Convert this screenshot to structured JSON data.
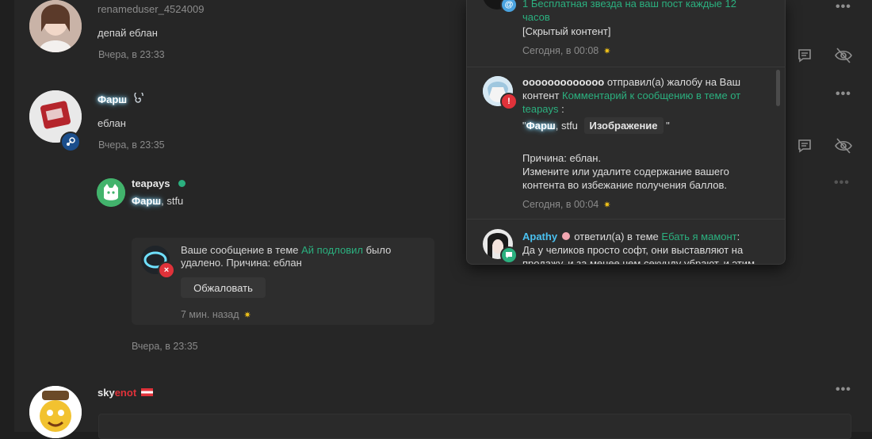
{
  "feed": {
    "post1": {
      "username": "renameduser_4524009",
      "text": "депай еблан",
      "time": "Вчера, в 23:33"
    },
    "post2": {
      "username": "Фарш",
      "text": "еблан",
      "time": "Вчера, в 23:35"
    },
    "reply": {
      "username": "teapays",
      "name_prefix": "Фарш",
      "text": ", stfu"
    },
    "notice": {
      "text_before": "Ваше сообщение в теме ",
      "link": "Ай подловил",
      "text_after": " было удалено. Причина: еблан",
      "button": "Обжаловать",
      "time": "7 мин. назад"
    },
    "reply_time": "Вчера, в 23:35",
    "post3": {
      "user_part1": "sky",
      "user_part2": "enot"
    }
  },
  "popup": {
    "n1": {
      "link": "1 Бесплатная звезда на ваш пост каждые 12 часов",
      "text": "[Скрытый контент]",
      "time": "Сегодня, в 00:08"
    },
    "n2": {
      "user": "ооооооооооооо",
      "text1": " отправил(а) жалобу на Ваш контент ",
      "link": "Комментарий к сообщению в теме от teapays",
      "text2": " :",
      "quote_open": "\"",
      "quote_name": "Фарш",
      "quote_text": ", stfu",
      "image_tag": "Изображение",
      "quote_close": " \"",
      "reason1": "Причина: еблан.",
      "reason2": "Измените или удалите содержание вашего контента во избежание получения баллов.",
      "time": "Сегодня, в 00:04"
    },
    "n3": {
      "user": "Apathy",
      "text1": " ответил(а) в теме ",
      "link": "Ебать я мамонт",
      "text2": ":",
      "body": "Да у челиков просто софт, они выставляют на продажу, и за менее чем секунду убрают, и этим"
    }
  },
  "colors": {
    "accent": "#2bb07f",
    "link_blue": "#4aa3df",
    "star": "#f5c518",
    "danger": "#e0323a"
  }
}
